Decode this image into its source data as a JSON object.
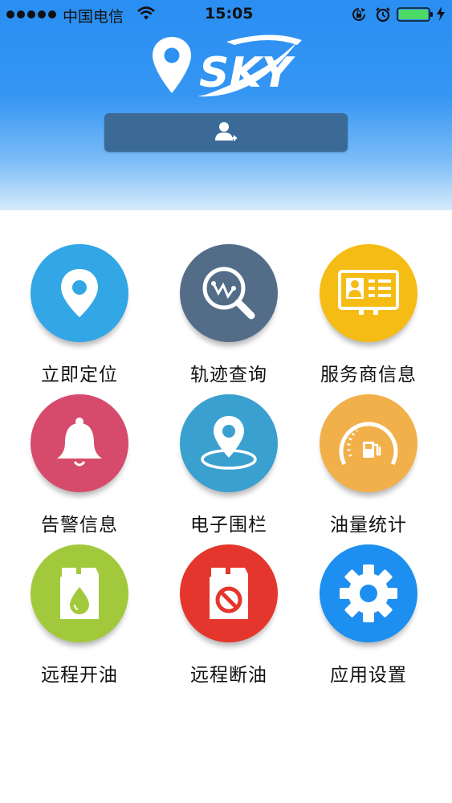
{
  "status_bar": {
    "carrier": "中国电信",
    "time": "15:05"
  },
  "header": {
    "logo_text": "SKY",
    "login_button_icon": "user-login-icon"
  },
  "menu": [
    {
      "label": "立即定位",
      "icon": "location-pin-icon",
      "color": "#33a6e6"
    },
    {
      "label": "轨迹查询",
      "icon": "track-search-icon",
      "color": "#536d88"
    },
    {
      "label": "服务商信息",
      "icon": "id-card-icon",
      "color": "#f5bc16"
    },
    {
      "label": "告警信息",
      "icon": "bell-icon",
      "color": "#d64b6c"
    },
    {
      "label": "电子围栏",
      "icon": "geofence-icon",
      "color": "#3aa0cf"
    },
    {
      "label": "油量统计",
      "icon": "fuel-gauge-icon",
      "color": "#f1b04a"
    },
    {
      "label": "远程开油",
      "icon": "oil-can-icon",
      "color": "#a2c93b"
    },
    {
      "label": "远程断油",
      "icon": "oil-cut-icon",
      "color": "#e4362c"
    },
    {
      "label": "应用设置",
      "icon": "gear-icon",
      "color": "#1d8ff0"
    }
  ]
}
